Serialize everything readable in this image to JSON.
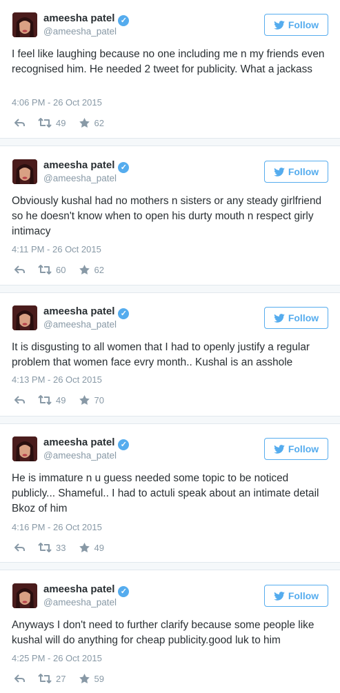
{
  "follow_label": "Follow",
  "tweets": [
    {
      "name": "ameesha patel",
      "handle": "@ameesha_patel",
      "text": "I feel like laughing because no one including me n my friends even recognised him. He needed 2 tweet for publicity. What a jackass",
      "time": "4:06 PM - 26 Oct 2015",
      "retweets": "49",
      "likes": "62"
    },
    {
      "name": "ameesha patel",
      "handle": "@ameesha_patel",
      "text": "Obviously kushal had no mothers n sisters or any steady girlfriend so he doesn't know when to open his durty mouth n respect girly intimacy",
      "time": "4:11 PM - 26 Oct 2015",
      "retweets": "60",
      "likes": "62"
    },
    {
      "name": "ameesha patel",
      "handle": "@ameesha_patel",
      "text": "It is disgusting to all women that I had to openly justify a regular problem that women face evry month.. Kushal is an asshole",
      "time": "4:13 PM - 26 Oct 2015",
      "retweets": "49",
      "likes": "70"
    },
    {
      "name": "ameesha patel",
      "handle": "@ameesha_patel",
      "text": "He is immature n u guess needed some topic to be noticed publicly... Shameful.. I had to actuli speak about an intimate detail Bkoz of him",
      "time": "4:16 PM - 26 Oct 2015",
      "retweets": "33",
      "likes": "49"
    },
    {
      "name": "ameesha patel",
      "handle": "@ameesha_patel",
      "text": "Anyways I don't need to further clarify because some people like kushal will do anything for cheap publicity.good luk to him",
      "time": "4:25 PM - 26 Oct 2015",
      "retweets": "27",
      "likes": "59"
    }
  ],
  "colors": {
    "twitter_blue": "#55acee",
    "text": "#292f33",
    "meta": "#8899a6",
    "separator": "#f5f8fa"
  },
  "icons": [
    "verified-badge-icon",
    "twitter-bird-icon",
    "reply-icon",
    "retweet-icon",
    "like-star-icon"
  ]
}
